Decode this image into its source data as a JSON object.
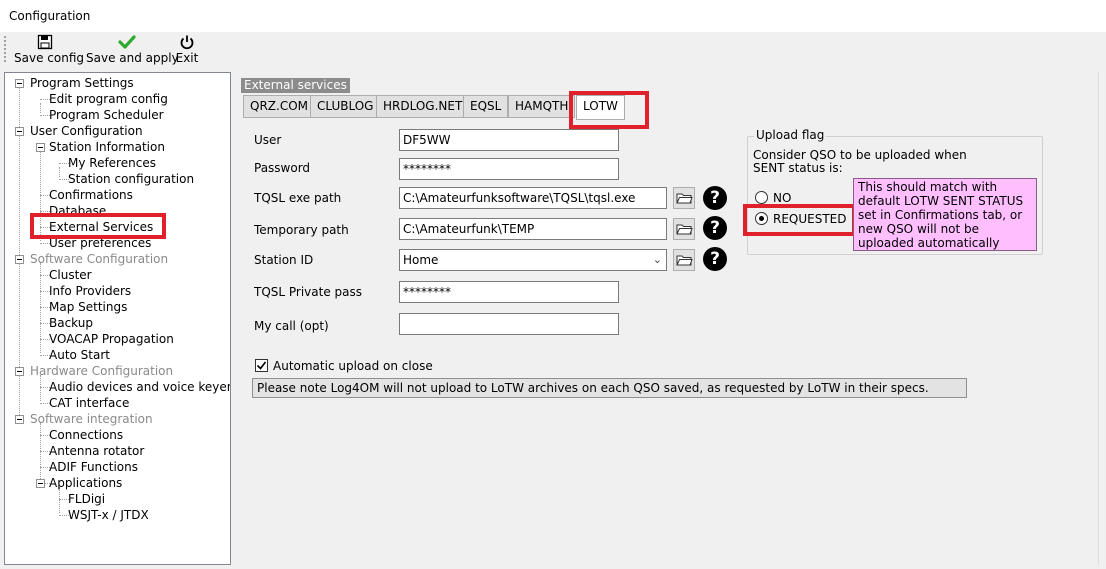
{
  "window": {
    "title": "Configuration"
  },
  "toolbar": {
    "save_config": "Save config",
    "save_and_apply": "Save and apply",
    "exit": "Exit",
    "icons": {
      "save": "floppy-disk-icon",
      "apply": "green-check-icon",
      "exit": "power-icon"
    }
  },
  "tree": {
    "program_settings": "Program Settings",
    "edit_program_config": "Edit program config",
    "program_scheduler": "Program Scheduler",
    "user_configuration": "User Configuration",
    "station_information": "Station Information",
    "my_references": "My References",
    "station_configuration": "Station configuration",
    "confirmations": "Confirmations",
    "database": "Database",
    "external_services": "External Services",
    "user_preferences": "User preferences",
    "software_configuration": "Software Configuration",
    "cluster": "Cluster",
    "info_providers": "Info Providers",
    "map_settings": "Map Settings",
    "backup": "Backup",
    "voacap_propagation": "VOACAP Propagation",
    "auto_start": "Auto Start",
    "hardware_configuration": "Hardware Configuration",
    "audio_devices": "Audio devices and voice keyer",
    "cat_interface": "CAT interface",
    "software_integration": "Software integration",
    "connections": "Connections",
    "antenna_rotator": "Antenna rotator",
    "adif_functions": "ADIF Functions",
    "applications": "Applications",
    "fldigi": "FLDigi",
    "wsjtx": "WSJT-x / JTDX"
  },
  "content": {
    "group_label": "External services",
    "tabs": [
      "QRZ.COM",
      "CLUBLOG",
      "HRDLOG.NET",
      "EQSL",
      "HAMQTH",
      "LOTW"
    ],
    "active_tab": "LOTW",
    "fields": {
      "user_label": "User",
      "user_value": "DF5WW",
      "password_label": "Password",
      "password_value": "********",
      "tqsl_exe_label": "TQSL exe path",
      "tqsl_exe_value": "C:\\Amateurfunksoftware\\TQSL\\tqsl.exe",
      "temp_path_label": "Temporary path",
      "temp_path_value": "C:\\Amateurfunk\\TEMP",
      "station_id_label": "Station ID",
      "station_id_value": "Home",
      "tqsl_pass_label": "TQSL Private pass",
      "tqsl_pass_value": "********",
      "my_call_label": "My call (opt)",
      "my_call_value": ""
    },
    "auto_upload_label": "Automatic upload on close",
    "auto_upload_checked": true,
    "note": "Please note Log4OM will not upload to LoTW archives on each QSO saved, as requested by LoTW in their specs.",
    "upload_flag": {
      "legend": "Upload flag",
      "description_line1": "Consider QSO to be uploaded when",
      "description_line2": "SENT status is:",
      "option_no": "NO",
      "option_requested": "REQUESTED",
      "selected": "REQUESTED",
      "hint": "This should match with default LOTW SENT STATUS set in Confirmations tab, or new QSO will not be uploaded automatically"
    }
  },
  "colors": {
    "highlight_red": "#e0202a",
    "hint_background": "#ffbfff",
    "group_label_bg": "#8c8c8c"
  }
}
